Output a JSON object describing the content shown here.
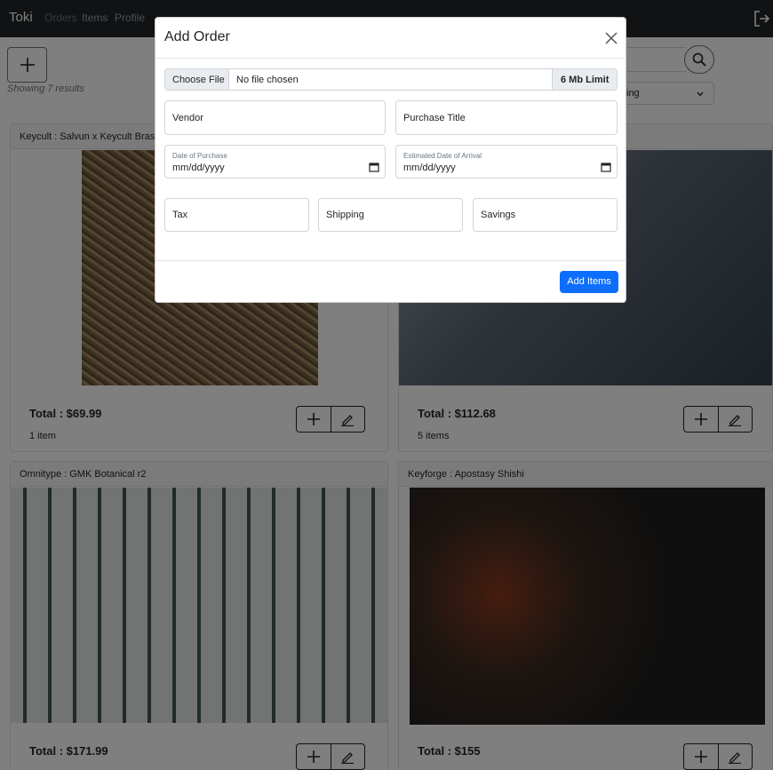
{
  "navbar": {
    "brand": "Toki",
    "links": [
      "Orders",
      "Items",
      "Profile"
    ]
  },
  "toolbar": {
    "results_text": "Showing 7 results",
    "sort_value": "ing"
  },
  "cards": [
    {
      "header": "Keycult : Salvun x Keycult Brass K",
      "total": "Total : $69.99",
      "items": "1 item"
    },
    {
      "header": "",
      "total": "Total : $112.68",
      "items": "5 items"
    },
    {
      "header": "Omnitype : GMK Botanical r2",
      "total": "Total : $171.99",
      "items": ""
    },
    {
      "header": "Keyforge : Apostasy Shishi",
      "total": "Total : $155",
      "items": ""
    }
  ],
  "modal": {
    "title": "Add Order",
    "file": {
      "button_label": "Choose File",
      "status": "No file chosen",
      "limit": "6 Mb Limit"
    },
    "vendor_placeholder": "Vendor",
    "purchase_title_placeholder": "Purchase Title",
    "date_of_purchase_label": "Date of Purchase",
    "date_of_purchase_value": "mm/dd/yyyy",
    "eta_label": "Estimated Date of Arrival",
    "eta_value": "mm/dd/yyyy",
    "tax_placeholder": "Tax",
    "shipping_placeholder": "Shipping",
    "savings_placeholder": "Savings",
    "submit_label": "Add Items"
  },
  "colors": {
    "navbar": "#212529",
    "primary": "#0d6efd",
    "backdrop": "rgba(0,0,0,0.5)"
  }
}
